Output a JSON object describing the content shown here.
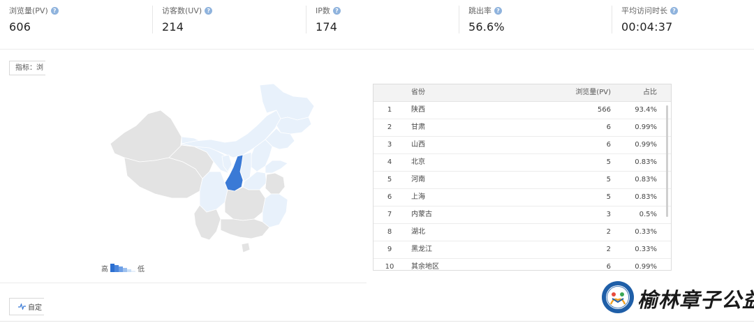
{
  "stats": [
    {
      "label": "浏览量(PV)",
      "value": "606"
    },
    {
      "label": "访客数(UV)",
      "value": "214"
    },
    {
      "label": "IP数",
      "value": "174"
    },
    {
      "label": "跳出率",
      "value": "56.6%"
    },
    {
      "label": "平均访问时长",
      "value": "00:04:37"
    }
  ],
  "metric_select": {
    "label": "指标：",
    "value": "浏"
  },
  "legend": {
    "high": "高",
    "low": "低"
  },
  "colors": {
    "highlight": "#3a7ad6",
    "light": "#e8f1fb",
    "gray": "#e2e2e2",
    "header": "#f3f3f3"
  },
  "table": {
    "headers": {
      "province": "省份",
      "pv": "浏览量(PV)",
      "pct": "占比"
    },
    "rows": [
      {
        "rank": "1",
        "province": "陕西",
        "pv": "566",
        "pct": "93.4%"
      },
      {
        "rank": "2",
        "province": "甘肃",
        "pv": "6",
        "pct": "0.99%"
      },
      {
        "rank": "3",
        "province": "山西",
        "pv": "6",
        "pct": "0.99%"
      },
      {
        "rank": "4",
        "province": "北京",
        "pv": "5",
        "pct": "0.83%"
      },
      {
        "rank": "5",
        "province": "河南",
        "pv": "5",
        "pct": "0.83%"
      },
      {
        "rank": "6",
        "province": "上海",
        "pv": "5",
        "pct": "0.83%"
      },
      {
        "rank": "7",
        "province": "内蒙古",
        "pv": "3",
        "pct": "0.5%"
      },
      {
        "rank": "8",
        "province": "湖北",
        "pv": "2",
        "pct": "0.33%"
      },
      {
        "rank": "9",
        "province": "黑龙江",
        "pv": "2",
        "pct": "0.33%"
      },
      {
        "rank": "10",
        "province": "其余地区",
        "pv": "6",
        "pct": "0.99%"
      }
    ]
  },
  "custom_button": {
    "label": "自定"
  },
  "watermark": {
    "text": "榆林章子公益"
  }
}
